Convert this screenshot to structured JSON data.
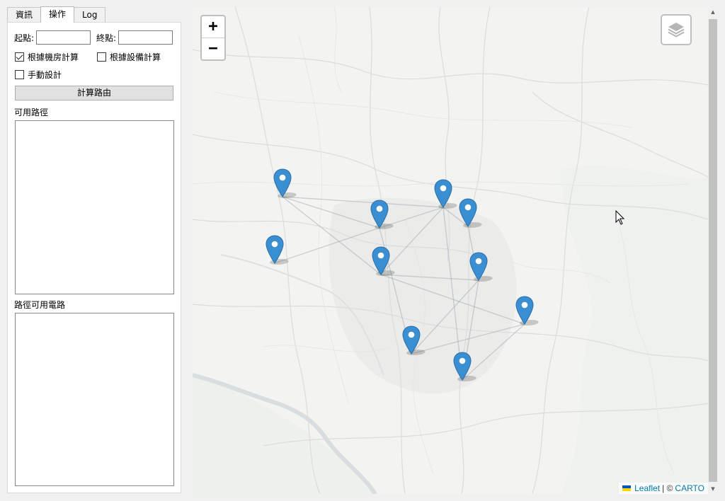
{
  "tabs": [
    "資訊",
    "操作",
    "Log"
  ],
  "form": {
    "start_label": "起點:",
    "start_value": "",
    "end_label": "終點:",
    "end_value": "",
    "opt_room": "根據機房計算",
    "opt_room_checked": true,
    "opt_device": "根據設備計算",
    "opt_device_checked": false,
    "opt_manual": "手動設計",
    "opt_manual_checked": false,
    "calc_button": "計算路由",
    "available_paths_label": "可用路徑",
    "path_circuits_label": "路徑可用電路"
  },
  "map": {
    "zoom_in": "+",
    "zoom_out": "−",
    "attribution_leaflet": "Leaflet",
    "attribution_sep": "| ©",
    "attribution_carto": "CARTO",
    "marker_color": "#3a8fd2"
  }
}
